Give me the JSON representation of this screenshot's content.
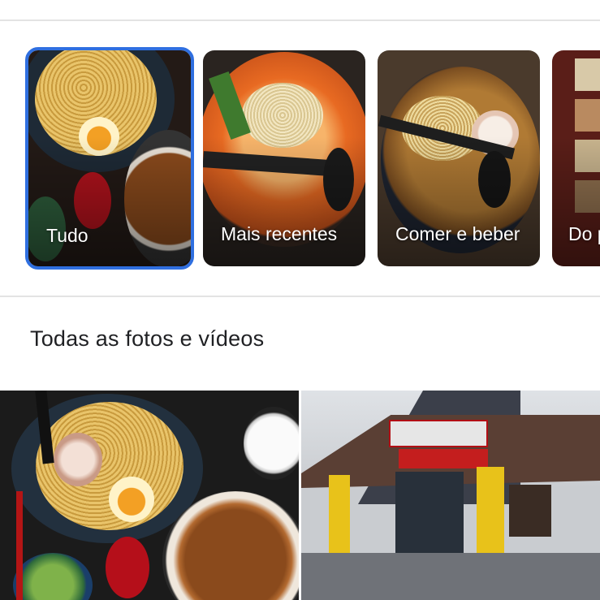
{
  "chips": [
    {
      "label": "Tudo",
      "selected": true
    },
    {
      "label": "Mais recentes",
      "selected": false
    },
    {
      "label": "Comer e beber",
      "selected": false
    },
    {
      "label": "Do pro",
      "selected": false
    }
  ],
  "section": {
    "title": "Todas as fotos e vídeos"
  },
  "colors": {
    "selection_border": "#2f6fe0",
    "divider": "#e3e3e3",
    "text": "#202124"
  },
  "photos": [
    {
      "name": "ramen-meal-photo"
    },
    {
      "name": "restaurant-exterior-photo"
    }
  ]
}
